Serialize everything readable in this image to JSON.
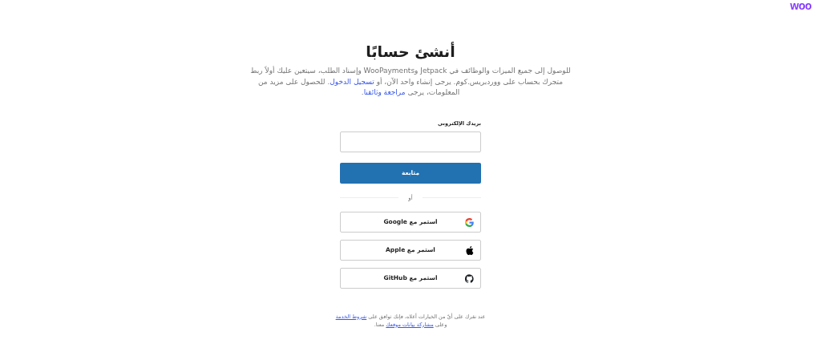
{
  "logo": {
    "text": "woo"
  },
  "title": "أنشئ حسابًا",
  "intro": [
    {
      "kind": "text",
      "text": "للوصول إلى جميع الميزات والوظائف في Jetpack وWooPayments وإسناد الطلب، سيتعين عليك أولاً ربط متجرك بحساب على ووردبريس.كوم. يرجى إنشاء واحد الآن، أو "
    },
    {
      "kind": "link",
      "text": "تسجيل الدخول"
    },
    {
      "kind": "text",
      "text": ". للحصول على مزيد من المعلومات، يرجى "
    },
    {
      "kind": "link",
      "text": "مراجعة وثائقنا"
    },
    {
      "kind": "text",
      "text": "."
    }
  ],
  "email": {
    "label": "بريدك الإلكتروني"
  },
  "submit": "متابعة",
  "divider": "أو",
  "social": [
    {
      "kind": "google",
      "label": "استمر مع Google"
    },
    {
      "kind": "apple",
      "label": "استمر مع Apple"
    },
    {
      "kind": "github",
      "label": "استمر مع GitHub"
    }
  ],
  "terms": [
    {
      "kind": "text",
      "text": "عند نقرك على أيّ من الخيارات أعلاه، فإنك توافق على "
    },
    {
      "kind": "link",
      "text": "شروط الخدمة"
    },
    {
      "kind": "text",
      "text": " وعلى "
    },
    {
      "kind": "link",
      "text": "مشاركة بيانات موقعك"
    },
    {
      "kind": "text",
      "text": " معنا."
    }
  ]
}
